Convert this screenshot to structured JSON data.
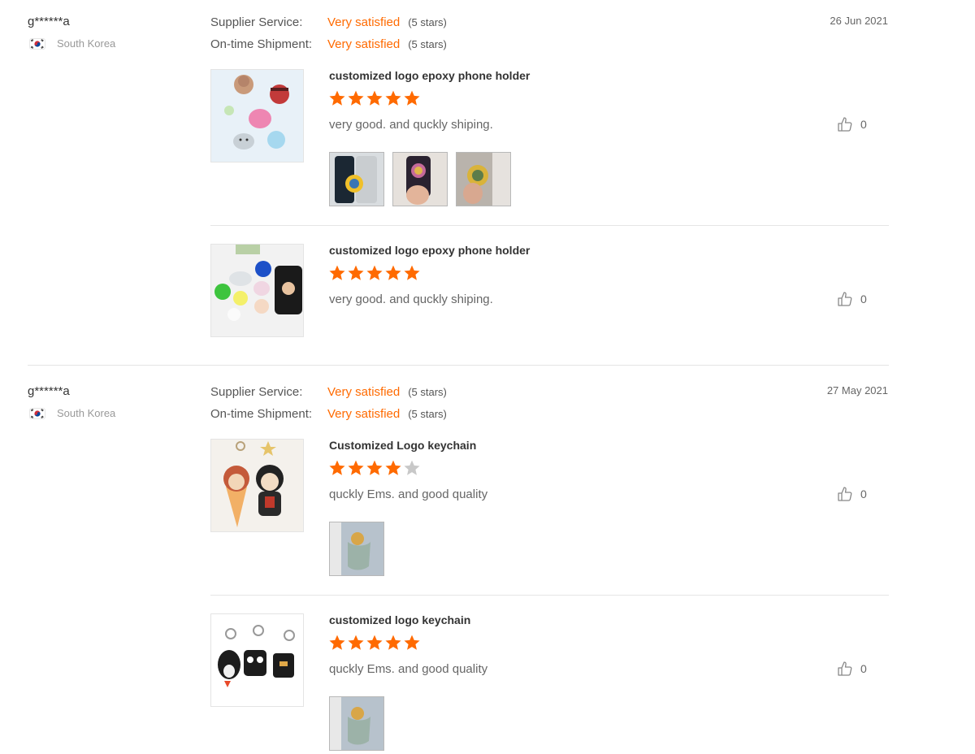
{
  "reviews": [
    {
      "user": "g******a",
      "country": "South Korea",
      "date": "26 Jun 2021",
      "supplier_service": {
        "label": "Supplier Service:",
        "value": "Very satisfied",
        "stars": "(5 stars)"
      },
      "shipment": {
        "label": "On-time Shipment:",
        "value": "Very satisfied",
        "stars": "(5 stars)"
      },
      "products": [
        {
          "name": "customized logo epoxy phone holder",
          "rating": 5,
          "comment": "very good. and quckly shiping.",
          "likes": "0",
          "photos": 3
        },
        {
          "name": "customized logo epoxy phone holder",
          "rating": 5,
          "comment": "very good. and quckly shiping.",
          "likes": "0",
          "photos": 0
        }
      ]
    },
    {
      "user": "g******a",
      "country": "South Korea",
      "date": "27 May 2021",
      "supplier_service": {
        "label": "Supplier Service:",
        "value": "Very satisfied",
        "stars": "(5 stars)"
      },
      "shipment": {
        "label": "On-time Shipment:",
        "value": "Very satisfied",
        "stars": "(5 stars)"
      },
      "products": [
        {
          "name": "Customized Logo keychain",
          "rating": 4,
          "comment": "quckly Ems. and good quality",
          "likes": "0",
          "photos": 1
        },
        {
          "name": "customized logo keychain",
          "rating": 5,
          "comment": "quckly Ems. and good quality",
          "likes": "0",
          "photos": 1
        }
      ]
    }
  ],
  "colors": {
    "accent": "#ff6a00",
    "star_empty": "#c8c8c8"
  },
  "icons": {
    "like": "thumbs-up-icon",
    "star": "star-icon",
    "flag": "south-korea-flag-icon"
  }
}
